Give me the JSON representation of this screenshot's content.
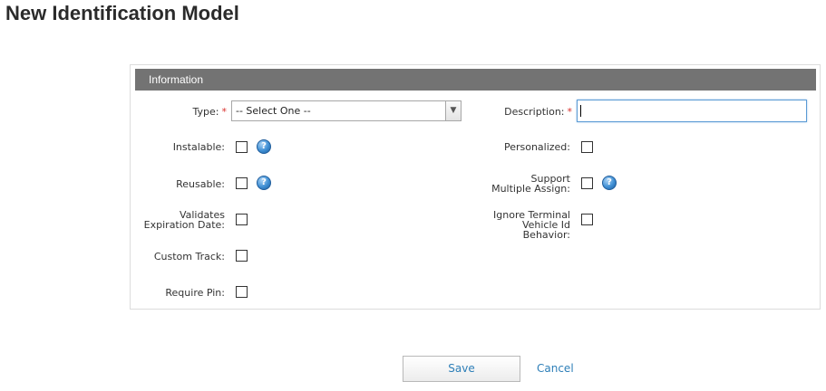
{
  "page": {
    "title": "New Identification Model"
  },
  "panel": {
    "header": "Information"
  },
  "form": {
    "type_label": "Type:",
    "required_mark": "*",
    "type_select_value": "-- Select One --",
    "description_label": "Description:",
    "description_value": "",
    "instalable_label": "Instalable:",
    "personalized_label": "Personalized:",
    "reusable_label": "Reusable:",
    "support_multiple_assign_label": "Support Multiple Assign:",
    "validates_expiration_date_label": "Validates Expiration Date:",
    "ignore_terminal_vehicle_id_label": "Ignore Terminal Vehicle Id Behavior:",
    "custom_track_label": "Custom Track:",
    "require_pin_label": "Require Pin:",
    "checkboxes": {
      "instalable": false,
      "personalized": false,
      "reusable": false,
      "support_multiple_assign": false,
      "validates_expiration_date": false,
      "ignore_terminal_vehicle_id": false,
      "custom_track": false,
      "require_pin": false
    }
  },
  "actions": {
    "save_label": "Save",
    "cancel_label": "Cancel"
  },
  "icons": {
    "help": "help-icon",
    "dropdown": "chevron-down-icon"
  },
  "colors": {
    "header_bg": "#737373",
    "link": "#2e7fb8",
    "required": "#d9302c"
  }
}
